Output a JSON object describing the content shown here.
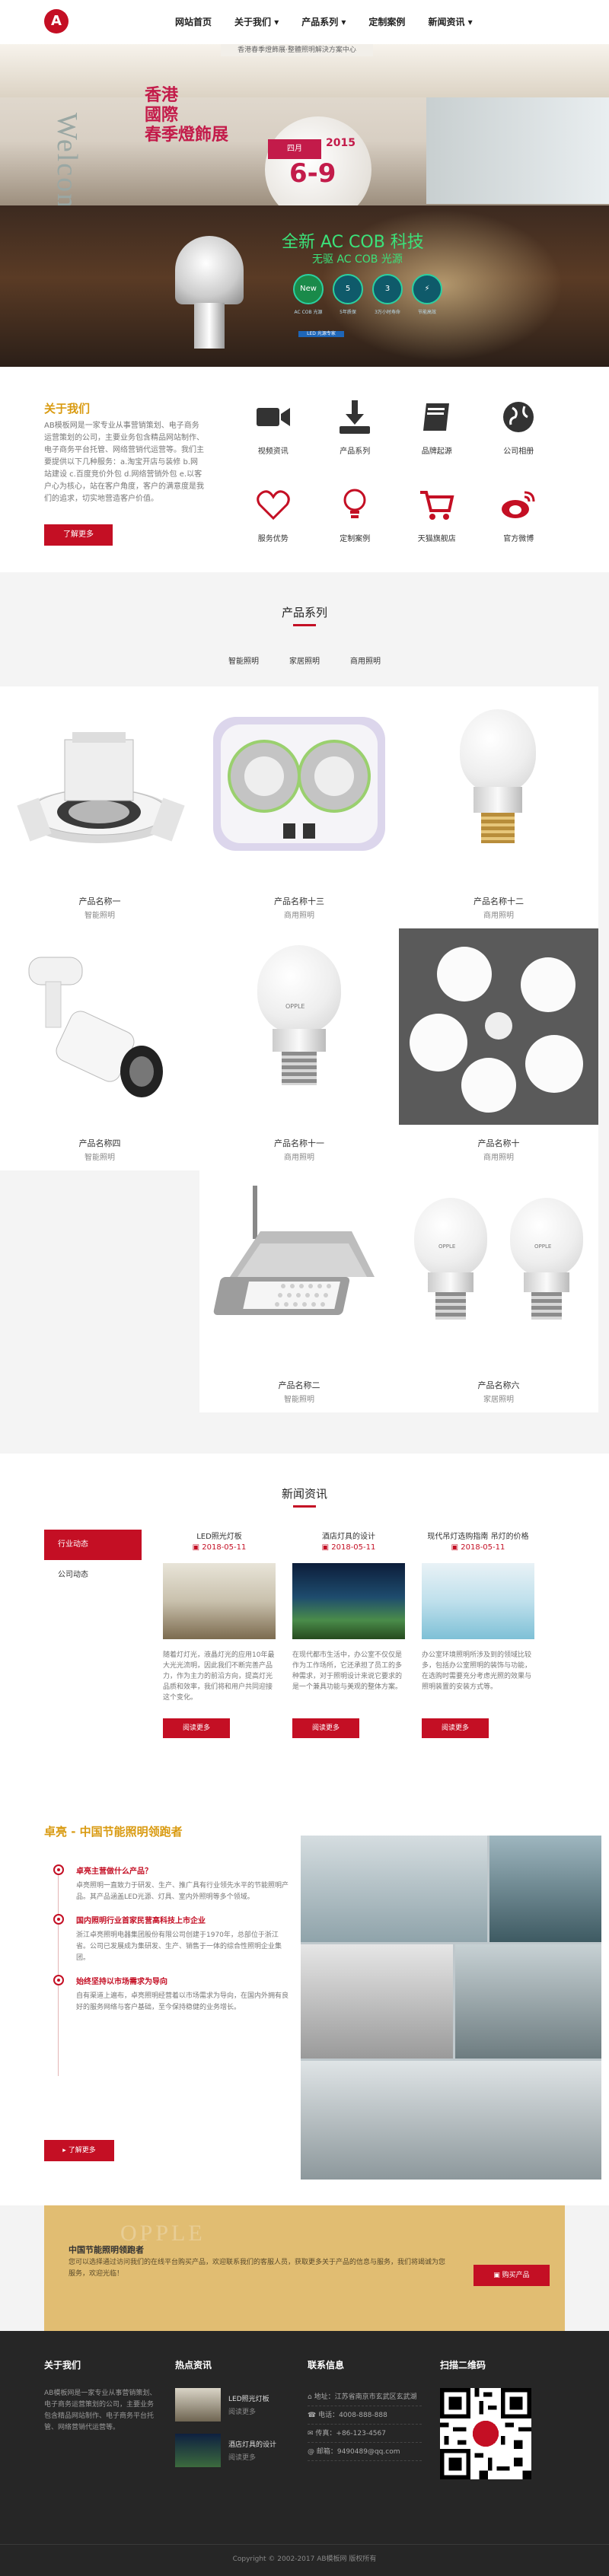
{
  "header": {
    "logo_letter": "A",
    "nav": [
      "网站首页",
      "关于我们 ▾",
      "产品系列 ▾",
      "定制案例",
      "新闻资讯 ▾"
    ]
  },
  "banner1": {
    "topbar": "香港春季燈飾展·整體照明解決方案中心",
    "welcome": "Welcome",
    "title_lines": [
      "香港",
      "國際",
      "春季燈飾展"
    ],
    "month": "四月",
    "year": "2015",
    "date": "6-9"
  },
  "banner2": {
    "title": "全新 AC COB 科技",
    "subtitle": "无驱 AC COB 光源",
    "badges": [
      {
        "text": "New",
        "caption": "AC COB 光源"
      },
      {
        "text": "5",
        "caption": "5年质保"
      },
      {
        "text": "3",
        "caption": "3万小时寿命"
      },
      {
        "text": "⚡",
        "caption": "节能高效"
      }
    ],
    "tag": "LED 光源专家"
  },
  "about": {
    "heading": "关于我们",
    "text": "AB模板网是一家专业从事营销策划、电子商务运营策划的公司，主要业务包含精品网站制作、电子商务平台托管、网络营销代运营等。我们主要提供以下几种服务：a.淘宝开店与装修 b.网站建设 c.百度竞价外包 d.网络营销外包 e.以客户心为核心，站在客户角度，客户的满意度是我们的追求，切实地营造客户价值。",
    "button": "了解更多",
    "icons": [
      {
        "name": "video-icon",
        "label": "视频资讯"
      },
      {
        "name": "download-icon",
        "label": "产品系列"
      },
      {
        "name": "book-icon",
        "label": "品牌起源"
      },
      {
        "name": "globe-icon",
        "label": "公司相册"
      },
      {
        "name": "heart-icon",
        "label": "服务优势"
      },
      {
        "name": "bulb-icon",
        "label": "定制案例"
      },
      {
        "name": "cart-icon",
        "label": "天猫旗舰店"
      },
      {
        "name": "weibo-icon",
        "label": "官方微博"
      }
    ]
  },
  "products": {
    "title": "产品系列",
    "tabs": [
      "智能照明",
      "家居照明",
      "商用照明"
    ],
    "items": [
      {
        "name": "产品名称一",
        "cat": "智能照明"
      },
      {
        "name": "产品名称十三",
        "cat": "商用照明"
      },
      {
        "name": "产品名称十二",
        "cat": "商用照明"
      },
      {
        "name": "产品名称四",
        "cat": "智能照明"
      },
      {
        "name": "产品名称十一",
        "cat": "商用照明"
      },
      {
        "name": "产品名称十",
        "cat": "商用照明"
      },
      {
        "name": "产品名称二",
        "cat": "智能照明"
      },
      {
        "name": "产品名称六",
        "cat": "家居照明"
      }
    ],
    "bulb_brand": "OPPLE"
  },
  "news": {
    "title": "新闻资讯",
    "side": [
      "行业动态",
      "公司动态"
    ],
    "cards": [
      {
        "title": "LED照光灯板",
        "date": "2018-05-11",
        "summary": "随着灯灯光，液晶灯光的应用10年最大光光流明，因此我们不断完善产品力，作为主力的前沿方向，提高灯光品质和效率，我们将和用户共同迎接这个变化。",
        "more": "阅读更多"
      },
      {
        "title": "酒店灯具的设计",
        "date": "2018-05-11",
        "summary": "在现代都市生活中，办公室不仅仅是作为工作场所，它还承担了员工的多种需求，对于照明设计来说它要求的是一个兼具功能与美观的整体方案。",
        "more": "阅读更多"
      },
      {
        "title": "现代吊灯选购指南 吊灯的价格",
        "date": "2018-05-11",
        "summary": "办公室环境照明所涉及到的领域比较多，包括办公室照明的装饰与功能，在选购时需要充分考虑光照的效果与照明装置的安装方式等。",
        "more": "阅读更多"
      }
    ]
  },
  "about2": {
    "heading": "卓亮 - 中国节能照明领跑者",
    "items": [
      {
        "q": "卓亮主营做什么产品？",
        "a": "卓亮照明一直致力于研发、生产、推广具有行业领先水平的节能照明产品。其产品涵盖LED光源、灯具、室内外照明等多个领域。"
      },
      {
        "q": "国内照明行业首家民营高科技上市企业",
        "a": "浙江卓亮照明电器集团股份有限公司创建于1970年，总部位于浙江省。公司已发展成为集研发、生产、销售于一体的综合性照明企业集团。"
      },
      {
        "q": "始终坚持以市场需求为导向",
        "a": "自有渠道上遍布，卓亮照明经营着以市场需求为导向，在国内外拥有良好的服务网络与客户基础，至今保持稳健的业务增长。"
      }
    ],
    "button": "了解更多"
  },
  "cta": {
    "title": "中国节能照明领跑者",
    "desc": "您可以选择通过访问我们的在线平台购买产品，欢迎联系我们的客服人员，获取更多关于产品的信息与服务，我们将竭诚为您服务，欢迎光临！",
    "button": "购买产品",
    "watermark": "OPPLE"
  },
  "footer": {
    "about_title": "关于我们",
    "about_text": "AB模板网是一家专业从事营销策划、电子商务运营策划的公司，主要业务包含精品网站制作、电子商务平台托管、网络营销代运营等。",
    "hot_title": "热点资讯",
    "hot": [
      "LED照光灯板",
      "酒店灯具的设计"
    ],
    "hot_more": "阅读更多",
    "contact_title": "联系信息",
    "contact": [
      "地址：江苏省南京市玄武区玄武湖",
      "电话：4008-888-888",
      "传真：+86-123-4567",
      "邮箱：9490489@qq.com"
    ],
    "qr_title": "扫描二维码",
    "copyright": "Copyright © 2002-2017 AB模板网 版权所有"
  }
}
